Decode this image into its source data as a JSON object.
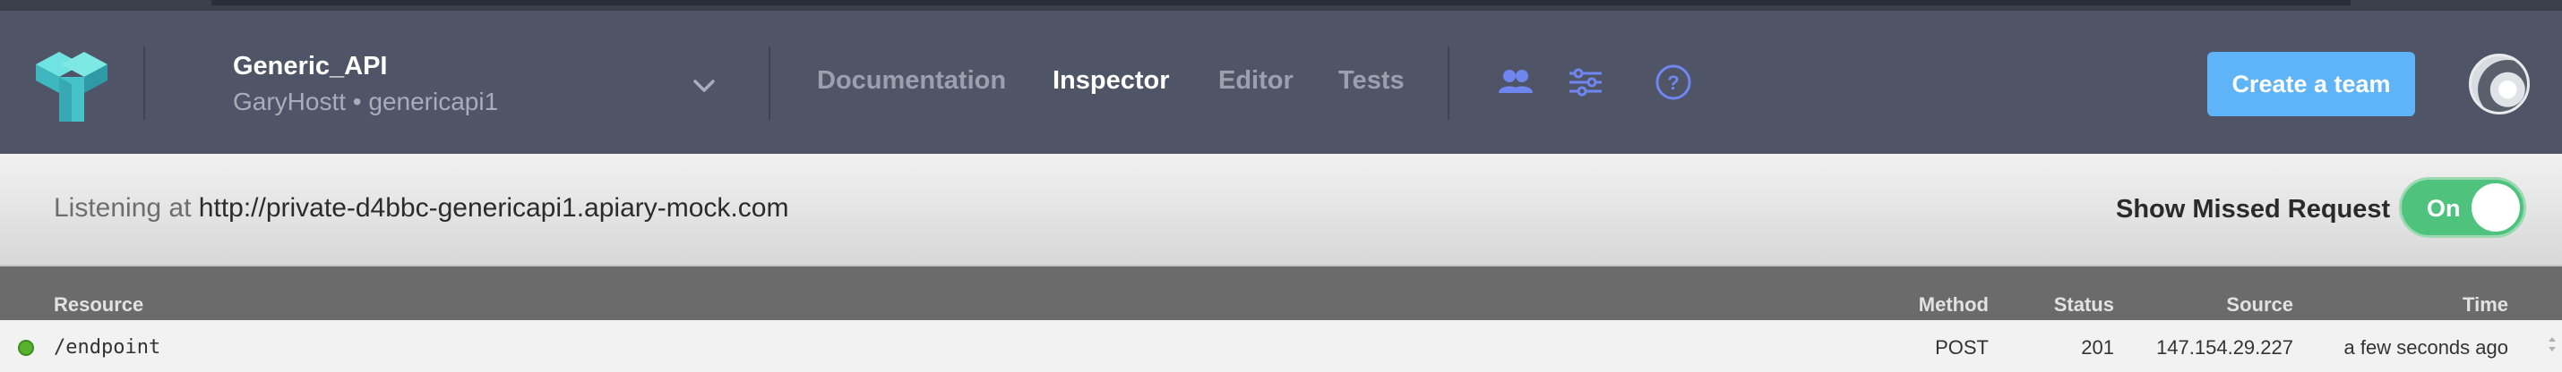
{
  "header": {
    "api_name": "Generic_API",
    "api_subtitle": "GaryHostt • genericapi1",
    "nav": [
      {
        "label": "Documentation",
        "active": false
      },
      {
        "label": "Inspector",
        "active": true
      },
      {
        "label": "Editor",
        "active": false
      },
      {
        "label": "Tests",
        "active": false
      }
    ],
    "icons": [
      "team-icon",
      "settings-sliders-icon",
      "help-icon"
    ],
    "create_team_label": "Create a team"
  },
  "listening": {
    "prefix": "Listening at",
    "url": "http://private-d4bbc-genericapi1.apiary-mock.com",
    "missed_label": "Show Missed Request",
    "toggle_label": "On",
    "toggle_state": "on"
  },
  "table": {
    "headers": {
      "resource": "Resource",
      "method": "Method",
      "status": "Status",
      "source": "Source",
      "time": "Time"
    },
    "rows": [
      {
        "resource": "/endpoint",
        "method": "POST",
        "status": "201",
        "source": "147.154.29.227",
        "time": "a few seconds ago",
        "indicator": "green"
      }
    ]
  },
  "colors": {
    "header_bg": "#4f5566",
    "accent_blue": "#5fb3f7",
    "toggle_green": "#4fc37d",
    "nav_icon_blue": "#6f86f0",
    "status_ok": "#58b22f"
  }
}
